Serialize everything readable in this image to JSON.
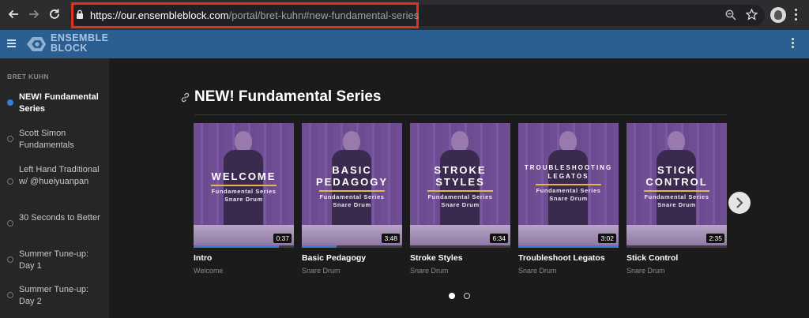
{
  "browser": {
    "url_host": "https://our.ensembleblock.com",
    "url_path": "/portal/bret-kuhn#new-fundamental-series"
  },
  "app": {
    "logo_line1": "ENSEMBLE",
    "logo_line2": "BLOCK",
    "brand_color": "#2c5f91"
  },
  "sidebar": {
    "section": "BRET KUHN",
    "items": [
      {
        "label": "NEW! Fundamental Series",
        "active": true
      },
      {
        "label": "Scott Simon Fundamentals",
        "active": false
      },
      {
        "label": "Left Hand Traditional w/ @hueiyuanpan",
        "active": false
      },
      {
        "label": "30 Seconds to Better",
        "active": false
      },
      {
        "label": "Summer Tune-up: Day 1",
        "active": false
      },
      {
        "label": "Summer Tune-up: Day 2",
        "active": false
      }
    ]
  },
  "main": {
    "title": "NEW! Fundamental Series",
    "cards": [
      {
        "title": "Intro",
        "subtitle": "Welcome",
        "duration": "0:37",
        "progress": 0.85,
        "overlay_lines": [
          "WELCOME"
        ],
        "overlay_sub": [
          "Fundamental Series",
          "Snare Drum"
        ]
      },
      {
        "title": "Basic Pedagogy",
        "subtitle": "Snare Drum",
        "duration": "3:48",
        "progress": 0.35,
        "overlay_lines": [
          "BASIC",
          "PEDAGOGY"
        ],
        "overlay_sub": [
          "Fundamental Series",
          "Snare Drum"
        ]
      },
      {
        "title": "Stroke Styles",
        "subtitle": "Snare Drum",
        "duration": "6:34",
        "progress": 0,
        "overlay_lines": [
          "STROKE",
          "STYLES"
        ],
        "overlay_sub": [
          "Fundamental Series",
          "Snare Drum"
        ]
      },
      {
        "title": "Troubleshoot Legatos",
        "subtitle": "Snare Drum",
        "duration": "3:02",
        "progress": 1,
        "overlay_lines": [
          "TROUBLESHOOTING",
          "LEGATOS"
        ],
        "overlay_sub": [
          "Fundamental Series",
          "Snare Drum"
        ]
      },
      {
        "title": "Stick Control",
        "subtitle": "Snare Drum",
        "duration": "2:35",
        "progress": 0,
        "overlay_lines": [
          "STICK",
          "CONTROL"
        ],
        "overlay_sub": [
          "Fundamental Series",
          "Snare Drum"
        ]
      }
    ],
    "pagination": {
      "pages": 2,
      "current": 1
    }
  }
}
